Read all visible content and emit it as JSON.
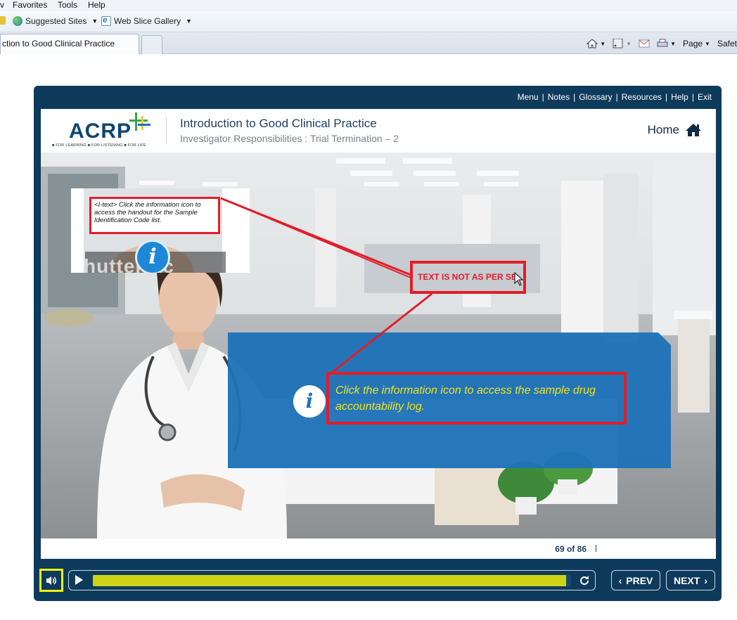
{
  "browser": {
    "menu": [
      "Favorites",
      "Tools",
      "Help"
    ],
    "favorites": [
      {
        "label": "Suggested Sites"
      },
      {
        "label": "Web Slice Gallery"
      }
    ],
    "tab_title": "ction to Good Clinical Practice",
    "commands": {
      "page": "Page",
      "safety": "Safet"
    }
  },
  "player": {
    "top_nav": [
      "Menu",
      "Notes",
      "Glossary",
      "Resources",
      "Help",
      "Exit"
    ],
    "logo": {
      "word": "ACRP",
      "tagline": "■ FOR LEARNING ■ FOR LISTENING ■ FOR LIFE"
    },
    "course_title": "Introduction to Good Clinical Practice",
    "slide_subtitle": "Investigator Responsibilities : Trial Termination – 2",
    "home_label": "Home",
    "thumb_note": "<I-text> Click the information icon to access the handout for the Sample Identification Code list.",
    "thumb_info_glyph": "i",
    "thumb_watermark": "hutterstc",
    "review_comment": "TEXT IS NOT AS PER SB",
    "info_glyph": "i",
    "main_text": "Click the information icon to access the sample drug accountability log.",
    "page_counter": "69 of 86",
    "progress_fraction": 0.99,
    "prev_label": "PREV",
    "next_label": "NEXT",
    "colors": {
      "frame": "#0e3a5c",
      "panel": "#1e73b8",
      "annotation": "#e21d2a",
      "highlight_text": "#f4e21a",
      "progress": "#cfd316"
    }
  }
}
